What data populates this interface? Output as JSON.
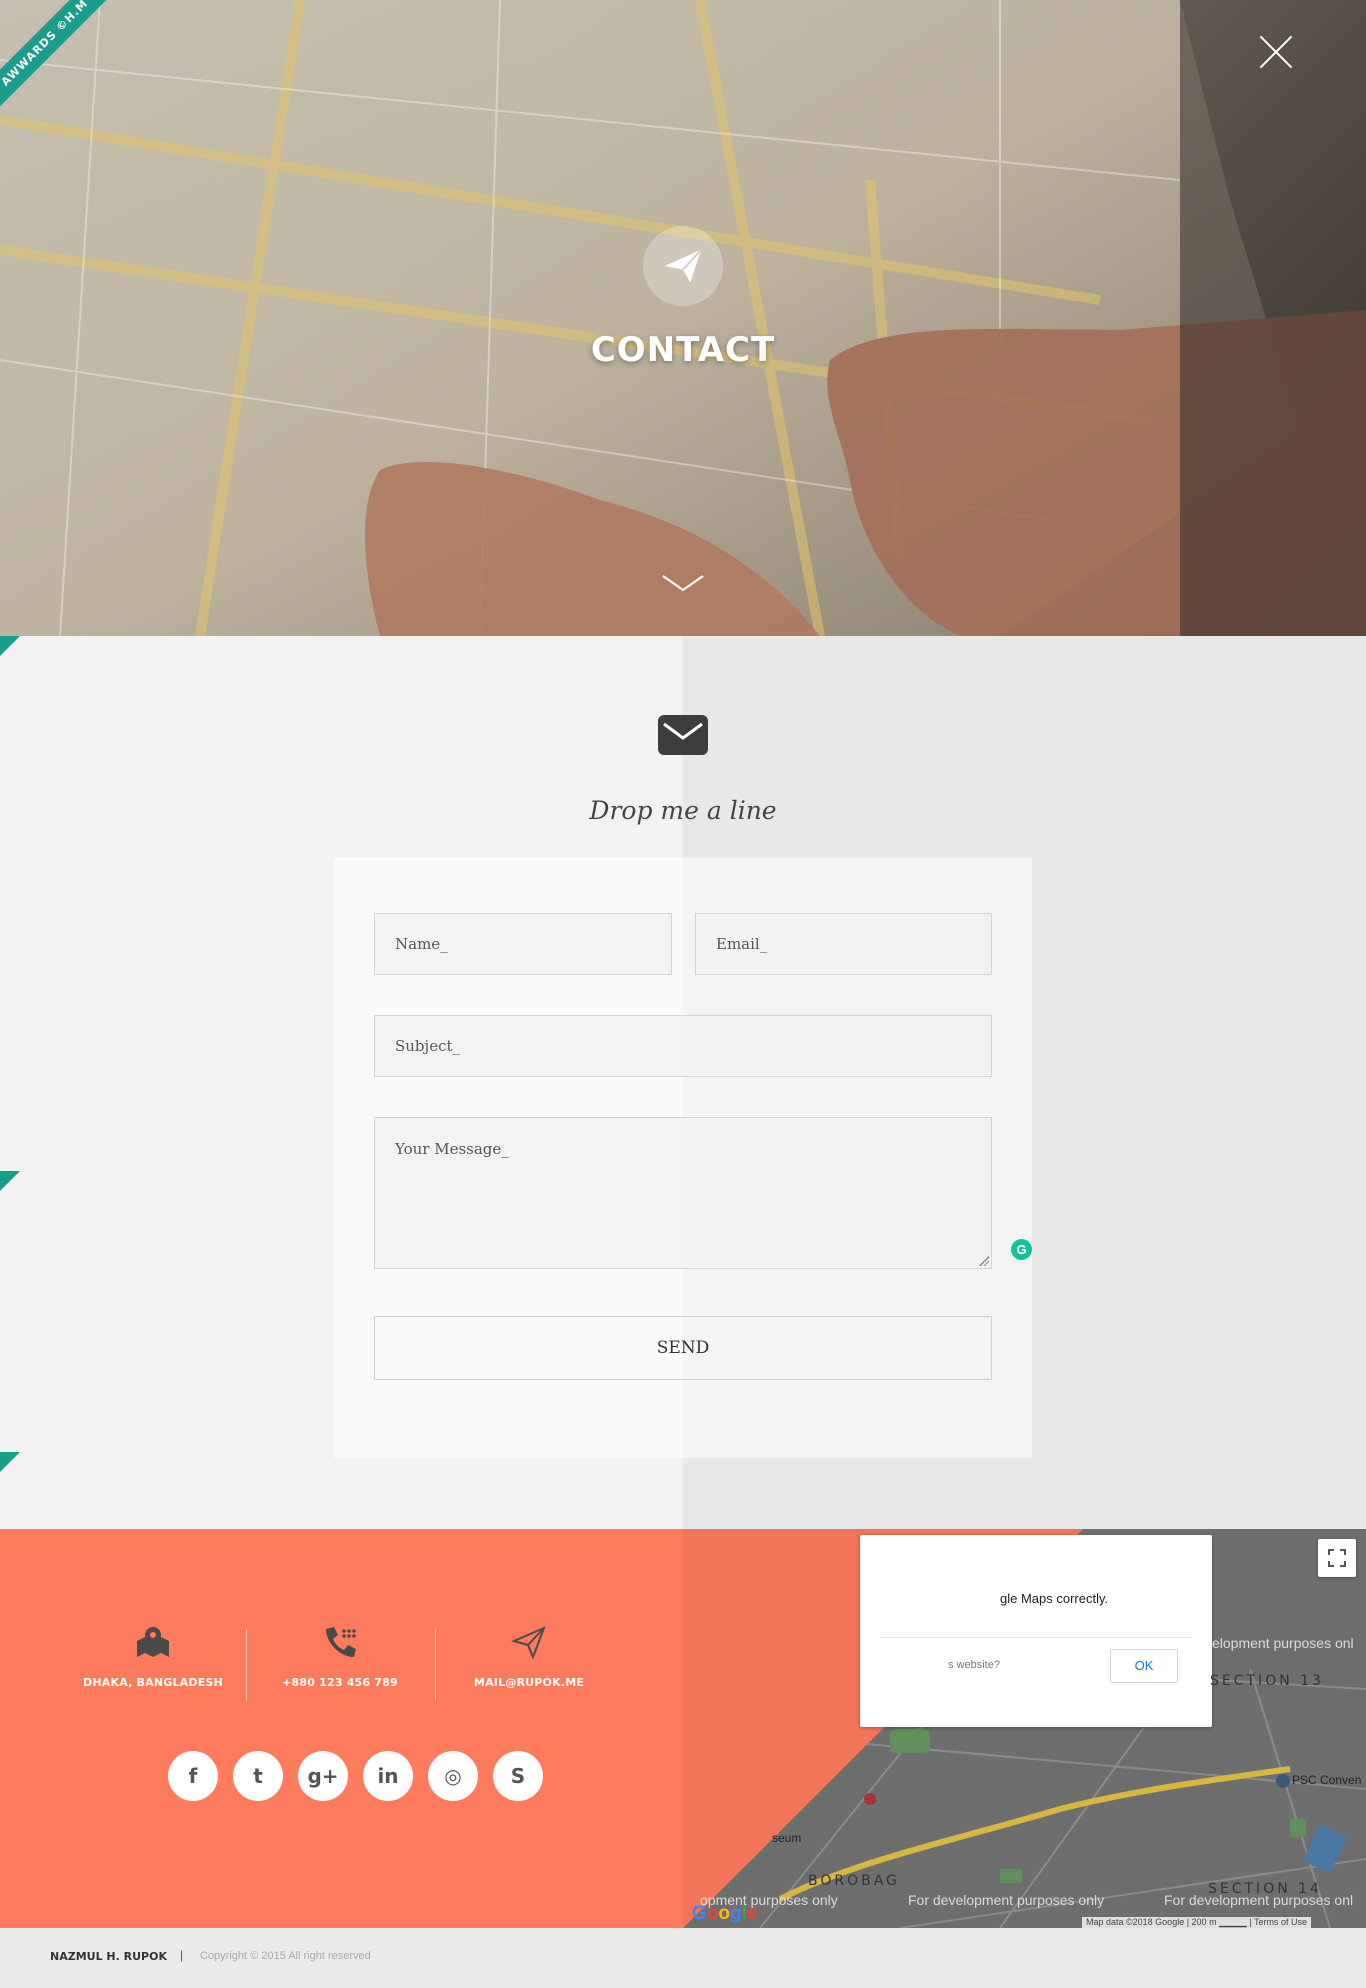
{
  "ribbon": {
    "text": "AWWARDS ©H.M"
  },
  "hero": {
    "title": "CONTACT"
  },
  "contact": {
    "heading": "Drop me a line",
    "fields": {
      "name_placeholder": "Name_",
      "email_placeholder": "Email_",
      "subject_placeholder": "Subject_",
      "message_placeholder": "Your Message_"
    },
    "send_label": "SEND"
  },
  "info": {
    "location": "DHAKA, BANGLADESH",
    "phone": "+880 123 456 789",
    "email": "MAIL@RUPOK.ME"
  },
  "social": [
    {
      "icon": "facebook-icon",
      "glyph": "f"
    },
    {
      "icon": "twitter-icon",
      "glyph": "t"
    },
    {
      "icon": "google-plus-icon",
      "glyph": "g+"
    },
    {
      "icon": "linkedin-icon",
      "glyph": "in"
    },
    {
      "icon": "dribbble-icon",
      "glyph": "◎"
    },
    {
      "icon": "skype-icon",
      "glyph": "S"
    }
  ],
  "map": {
    "dialog_message": "gle Maps correctly.",
    "dialog_question": "s website?",
    "ok_label": "OK",
    "watermark": "For development purposes only",
    "watermark_partial_top": "elopment purposes onl",
    "watermark_partial_left": "opment purposes only",
    "watermark_partial_right": "For development purposes onl",
    "section13": "SECTION 13",
    "section14": "SECTION 14",
    "borobag": "BOROBAG",
    "psc": "PSC Conven",
    "museum": "seum",
    "footer_data": "Map data ©2018 Google",
    "footer_scale": "200 m",
    "footer_terms": "Terms of Use",
    "google": "Google"
  },
  "footer": {
    "name": "NAZMUL H. RUPOK",
    "separator": "|",
    "copyright": "Copyright © 2015 All right reserved"
  },
  "colors": {
    "teal": "#1a9e8b",
    "coral": "#ff7b5e",
    "dark_icon": "#4a4a4a"
  }
}
